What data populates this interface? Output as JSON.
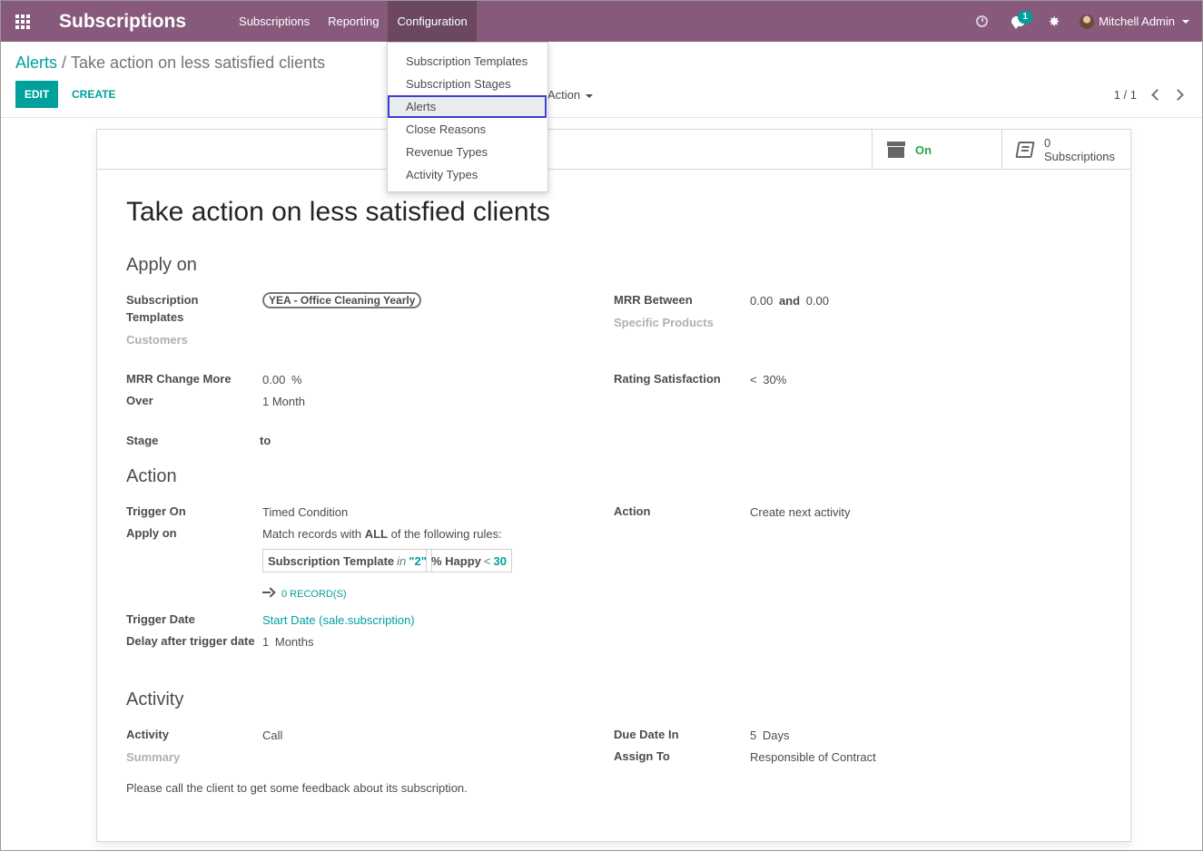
{
  "navbar": {
    "brand": "Subscriptions",
    "menu": [
      "Subscriptions",
      "Reporting",
      "Configuration"
    ],
    "messages_badge": "1",
    "user": "Mitchell Admin",
    "color": "#875a7b"
  },
  "breadcrumb": {
    "parent": "Alerts",
    "separator": "/",
    "current": "Take action on less satisfied clients"
  },
  "buttons": {
    "edit": "EDIT",
    "create": "CREATE",
    "action": "Action"
  },
  "pager": {
    "value": "1 / 1"
  },
  "dropdown": {
    "items": [
      "Subscription Templates",
      "Subscription Stages",
      "Alerts",
      "Close Reasons",
      "Revenue Types",
      "Activity Types"
    ],
    "highlighted": "Alerts"
  },
  "stat_buttons": {
    "active_label": "On",
    "subs_count": "0",
    "subs_label": "Subscriptions"
  },
  "form": {
    "title": "Take action on less satisfied clients",
    "apply_on": {
      "heading": "Apply on",
      "templates_label": "Subscription Templates",
      "templates_tag": "YEA - Office Cleaning Yearly",
      "customers_label": "Customers",
      "mrr_between_label": "MRR Between",
      "mrr_min": "0.00",
      "mrr_and": "and",
      "mrr_max": "0.00",
      "products_label": "Specific Products",
      "mrr_change_label": "MRR Change More",
      "mrr_change_value": "0.00",
      "mrr_change_unit": "%",
      "over_label": "Over",
      "over_value": "1 Month",
      "rating_label": "Rating Satisfaction",
      "rating_op": "<",
      "rating_value": "30",
      "rating_unit": "%",
      "stage_label": "Stage",
      "stage_to": "to"
    },
    "action": {
      "heading": "Action",
      "trigger_on_label": "Trigger On",
      "trigger_on_value": "Timed Condition",
      "action_label": "Action",
      "action_value": "Create next activity",
      "apply_on_label": "Apply on",
      "apply_prefix": "Match records with",
      "apply_all": "ALL",
      "apply_suffix": "of the following rules:",
      "rule1_field": "Subscription Template",
      "rule1_op": "in",
      "rule1_val": "\"2\"",
      "rule2_field": "% Happy",
      "rule2_op": "<",
      "rule2_val": "30",
      "records": "0 RECORD(S)",
      "trigger_date_label": "Trigger Date",
      "trigger_date_value": "Start Date (sale.subscription)",
      "delay_label": "Delay after trigger date",
      "delay_value": "1",
      "delay_unit": "Months"
    },
    "activity": {
      "heading": "Activity",
      "activity_label": "Activity",
      "activity_value": "Call",
      "summary_label": "Summary",
      "due_label": "Due Date In",
      "due_value": "5",
      "due_unit": "Days",
      "assign_label": "Assign To",
      "assign_value": "Responsible of Contract",
      "note": "Please call the client to get some feedback about its subscription."
    }
  }
}
